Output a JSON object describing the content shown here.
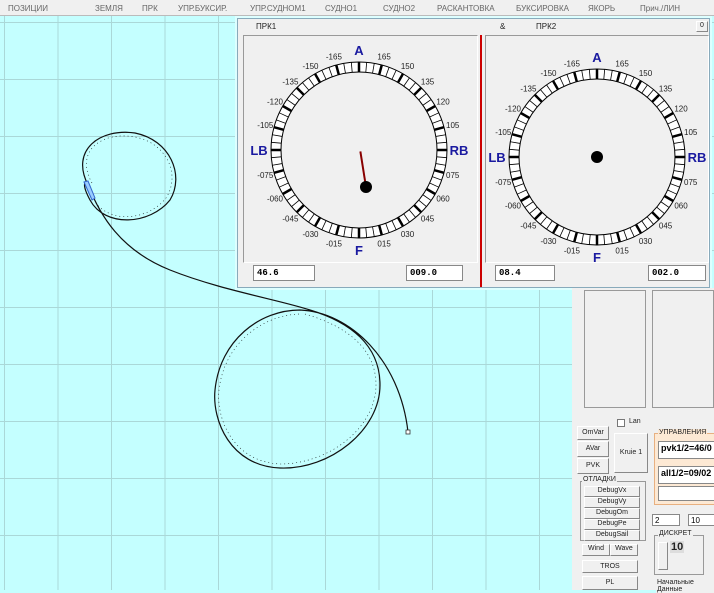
{
  "menu": [
    "ПОЗИЦИИ",
    "ЗЕМЛЯ",
    "ПРК",
    "УПР.БУКСИР.",
    "УПР.СУДНОМ1",
    "СУДНО1",
    "СУДНО2",
    "РАСКАНТОВКА",
    "БУКСИРОВКА",
    "ЯКОРЬ",
    "Прич./ЛИН"
  ],
  "window": {
    "title_left": "ПРК1",
    "amp": "&",
    "title_right": "ПРК2",
    "close": "0"
  },
  "dials": {
    "labels_pos": [
      "015",
      "030",
      "045",
      "060",
      "075",
      "RB",
      "105",
      "120",
      "135",
      "150",
      "165"
    ],
    "labels_neg": [
      "-015",
      "-030",
      "-045",
      "-060",
      "-075",
      "LB",
      "-105",
      "-120",
      "-135",
      "-150",
      "-165"
    ],
    "top": "A",
    "bottom": "F",
    "prk1": {
      "left_value": "46.6",
      "right_value": "009.0",
      "needle_angle_deg": -9
    },
    "prk2": {
      "left_value": "08.4",
      "right_value": "002.0"
    }
  },
  "controls": {
    "lan_label": "Lan",
    "omvar": "OmVar",
    "avar": "AVar",
    "pvk": "PVK",
    "kruie": "Kruie 1",
    "upravleniya": "УПРАВЛЕНИЯ",
    "pvk_value": "pvk1/2=46/0",
    "all_value": "all1/2=09/02",
    "otladki": "ОТЛАДКИ",
    "debug": [
      "DebugVx",
      "DebugVy",
      "DebugOm",
      "DebugPe",
      "DebugSail"
    ],
    "wind": "Wind",
    "wave": "Wave",
    "tros": "TROS",
    "pl": "PL",
    "field_a": "2",
    "field_b": "10",
    "diskret": "ДИСКРЕТ",
    "diskret_value": "10",
    "nachalnye": "Начальные Данные"
  },
  "colors": {
    "background": "#c4ffff",
    "divider": "#cc0000",
    "dial_label": "#1a1aa0"
  }
}
